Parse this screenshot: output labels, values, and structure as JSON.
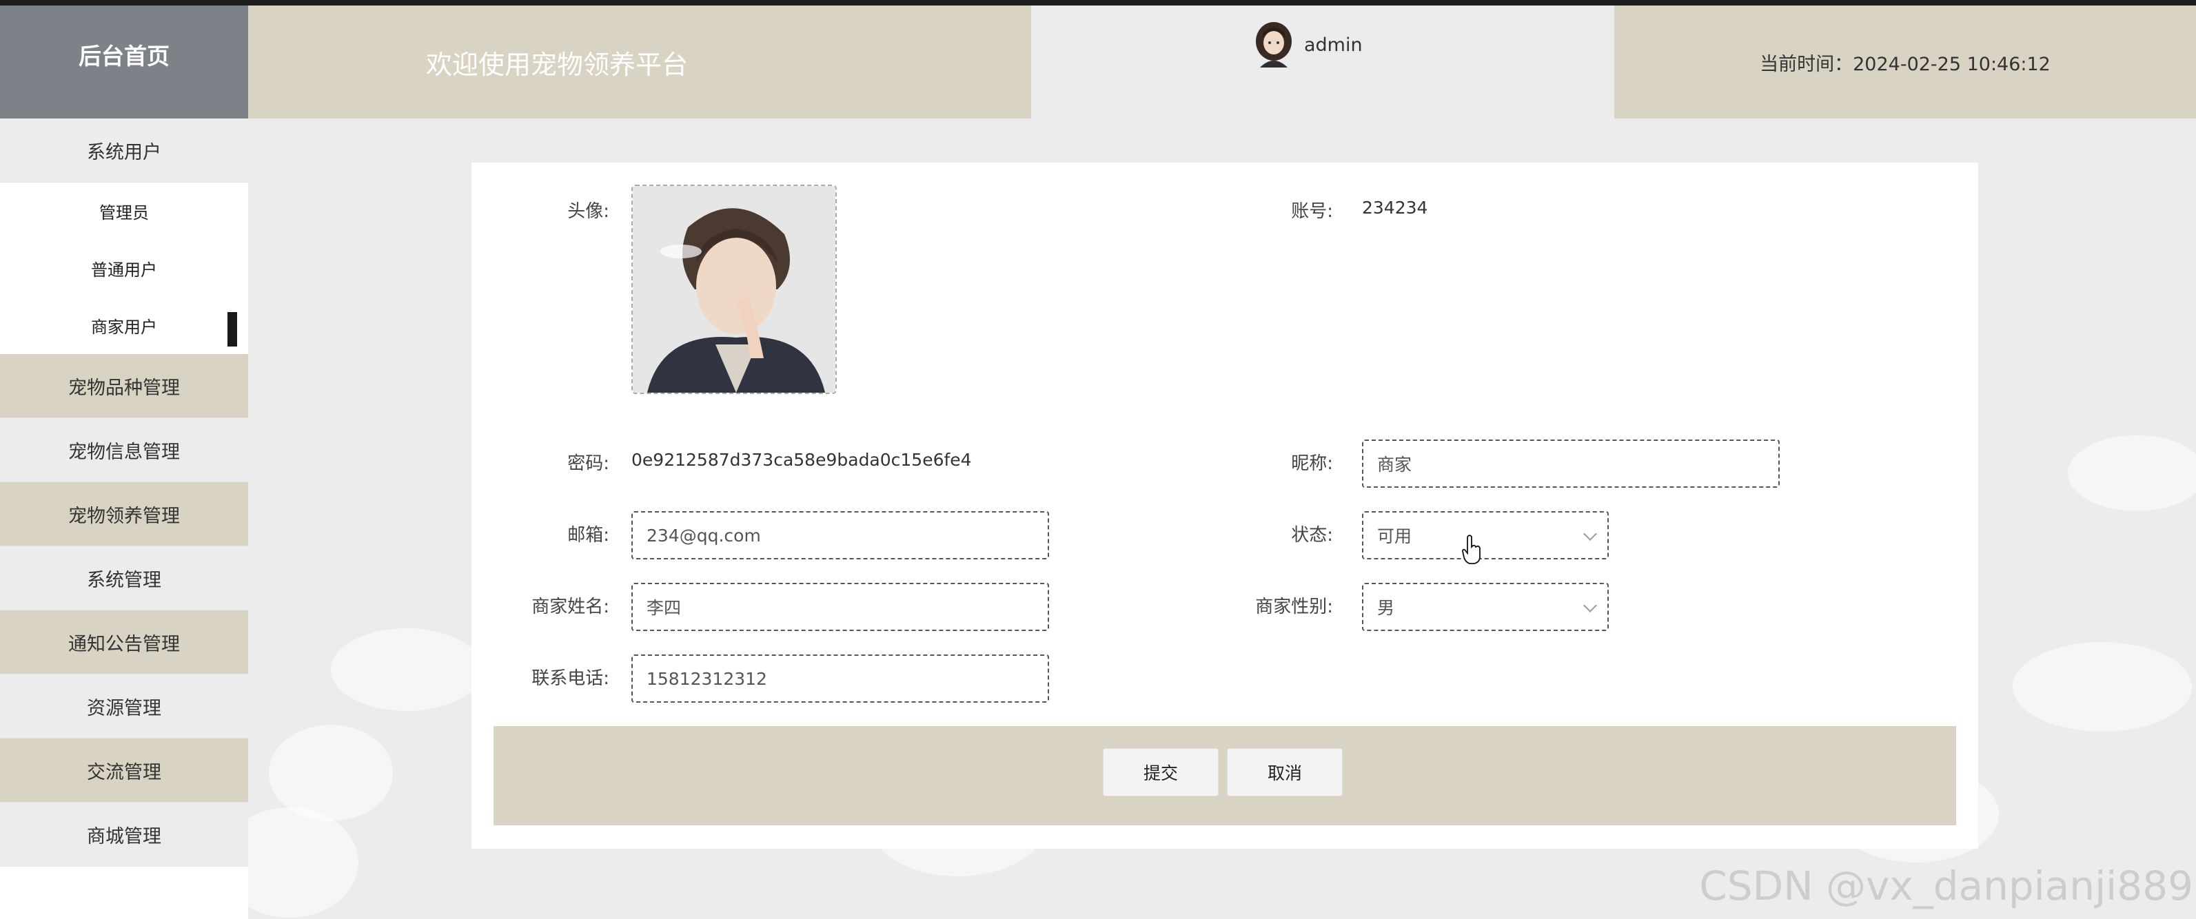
{
  "header": {
    "brand": "后台首页",
    "welcome": "欢迎使用宠物领养平台",
    "username": "admin",
    "time_text": "当前时间：2024-02-25 10:46:12"
  },
  "sidebar": {
    "group": "系统用户",
    "sub_items": [
      "管理员",
      "普通用户",
      "商家用户"
    ],
    "items": [
      "宠物品种管理",
      "宠物信息管理",
      "宠物领养管理",
      "系统管理",
      "通知公告管理",
      "资源管理",
      "交流管理",
      "商城管理"
    ]
  },
  "form": {
    "avatar_label": "头像:",
    "account_label": "账号:",
    "account_value": "234234",
    "password_label": "密码:",
    "password_value": "0e9212587d373ca58e9bada0c15e6fe4",
    "nickname_label": "昵称:",
    "nickname_value": "商家",
    "email_label": "邮箱:",
    "email_value": "234@qq.com",
    "status_label": "状态:",
    "status_value": "可用",
    "merchant_name_label": "商家姓名:",
    "merchant_name_value": "李四",
    "gender_label": "商家性别:",
    "gender_value": "男",
    "phone_label": "联系电话:",
    "phone_value": "15812312312"
  },
  "buttons": {
    "submit": "提交",
    "cancel": "取消"
  },
  "watermark": "CSDN @vx_danpianji889",
  "colors": {
    "beige": "#d8d3c3",
    "brand_gray": "#7d8289",
    "light_gray": "#ececec"
  }
}
